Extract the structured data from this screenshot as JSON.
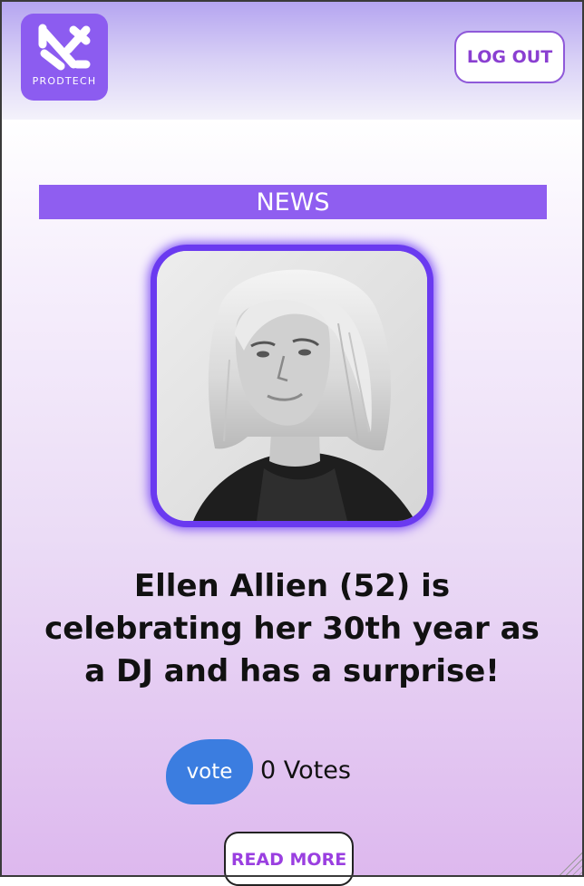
{
  "header": {
    "logo_text": "PRODTECH",
    "logout_label": "LOG OUT"
  },
  "main": {
    "section_title": "NEWS",
    "article": {
      "headline": "Ellen Allien (52) is celebrating her 30th year as a DJ and has a surprise!",
      "vote_label": "vote",
      "votes_text": "0 Votes",
      "read_more_label": "READ MORE"
    }
  },
  "colors": {
    "brand_purple": "#8c5cf0",
    "news_bar": "#8f5ef0",
    "vote_blue": "#3b7de0",
    "accent_text": "#9a3fe0"
  }
}
